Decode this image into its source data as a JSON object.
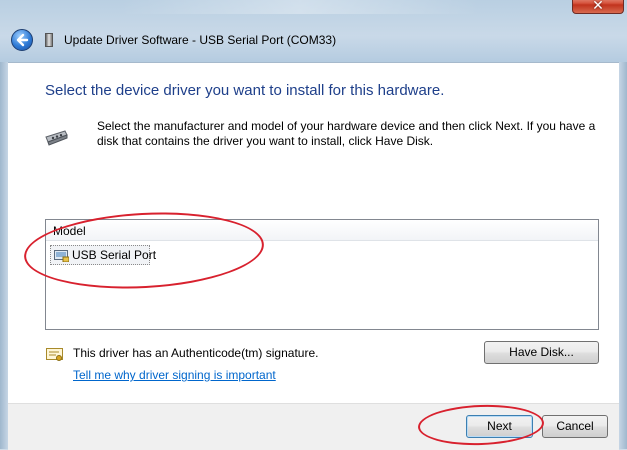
{
  "window": {
    "title": "Update Driver Software - USB Serial Port (COM33)",
    "close_label": "✕"
  },
  "content": {
    "heading": "Select the device driver you want to install for this hardware.",
    "instructions": "Select the manufacturer and model of your hardware device and then click Next. If you have a disk that contains the driver you want to install, click Have Disk.",
    "list": {
      "column_header": "Model",
      "items": [
        {
          "label": "USB Serial Port",
          "icon": "device-port-icon"
        }
      ]
    },
    "signature_text": "This driver has an Authenticode(tm) signature.",
    "signature_link": "Tell me why driver signing is important"
  },
  "buttons": {
    "have_disk": "Have Disk...",
    "next": "Next",
    "cancel": "Cancel"
  },
  "colors": {
    "heading": "#1e3f8a",
    "link": "#0066cc",
    "annotation": "#d8212e"
  }
}
